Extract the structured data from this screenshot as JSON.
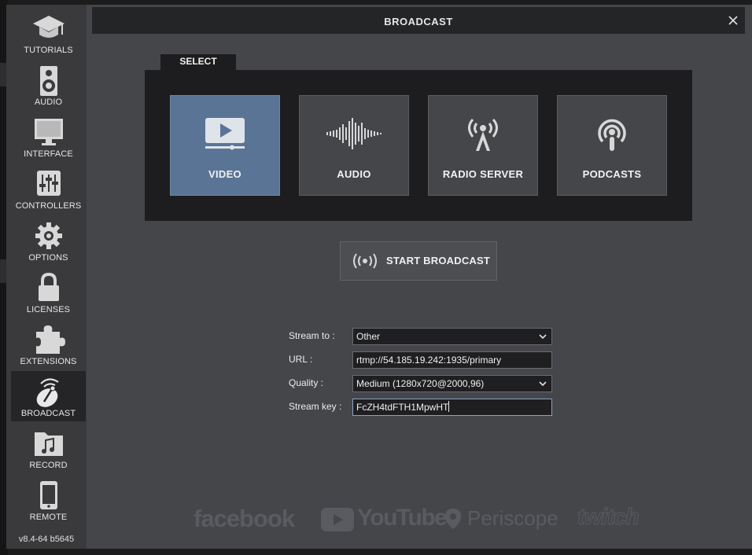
{
  "sidebar": {
    "items": [
      {
        "label": "TUTORIALS",
        "icon": "graduation-cap-icon"
      },
      {
        "label": "AUDIO",
        "icon": "speaker-icon"
      },
      {
        "label": "INTERFACE",
        "icon": "monitor-icon"
      },
      {
        "label": "CONTROLLERS",
        "icon": "sliders-icon"
      },
      {
        "label": "OPTIONS",
        "icon": "gear-icon"
      },
      {
        "label": "LICENSES",
        "icon": "lock-icon"
      },
      {
        "label": "EXTENSIONS",
        "icon": "puzzle-icon"
      },
      {
        "label": "BROADCAST",
        "icon": "broadcast-icon",
        "active": true
      },
      {
        "label": "RECORD",
        "icon": "music-folder-icon"
      },
      {
        "label": "REMOTE",
        "icon": "phone-icon"
      }
    ],
    "version": "v8.4-64 b5645"
  },
  "dialog": {
    "title": "BROADCAST",
    "select_tab": "SELECT",
    "tiles": [
      {
        "label": "VIDEO",
        "icon": "video-play-icon",
        "active": true
      },
      {
        "label": "AUDIO",
        "icon": "waveform-icon"
      },
      {
        "label": "RADIO SERVER",
        "icon": "radio-tower-icon"
      },
      {
        "label": "PODCASTS",
        "icon": "podcast-icon"
      }
    ],
    "start_button": "START BROADCAST"
  },
  "form": {
    "stream_to": {
      "label": "Stream to :",
      "value": "Other"
    },
    "url": {
      "label": "URL :",
      "value": "rtmp://54.185.19.242:1935/primary"
    },
    "quality": {
      "label": "Quality :",
      "value": "Medium (1280x720@2000,96)"
    },
    "stream_key": {
      "label": "Stream key :",
      "value": "FcZH4tdFTH1MpwHT"
    }
  },
  "logos": {
    "facebook": "facebook",
    "youtube": "YouTube",
    "periscope": "Periscope",
    "twitch": "twitch"
  },
  "colors": {
    "accent_active_tile": "#5a7496",
    "dialog_bg": "#45464a",
    "panel_bg": "#1d1d1f"
  }
}
